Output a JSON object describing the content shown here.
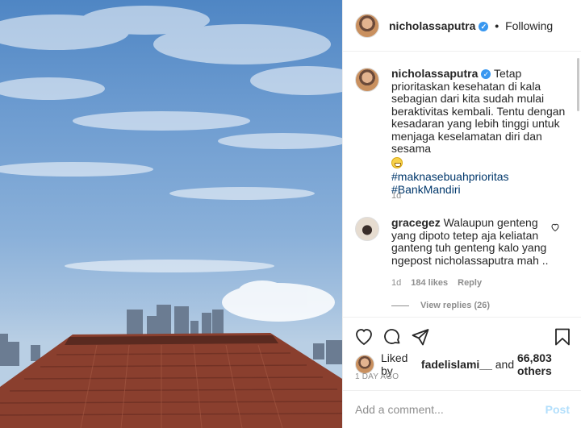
{
  "header": {
    "username": "nicholassaputra",
    "separator": "•",
    "follow_status": "Following"
  },
  "caption": {
    "username": "nicholassaputra",
    "text": "Tetap prioritaskan kesehatan di kala sebagian dari kita sudah mulai beraktivitas kembali. Tentu dengan kesadaran yang lebih tinggi untuk menjaga keselamatan diri dan sesama",
    "hashtags": [
      "#maknasebuahprioritas",
      "#BankMandiri"
    ],
    "time": "1d"
  },
  "comment": {
    "username": "gracegez",
    "text": "Walaupun genteng yang dipoto tetep aja keliatan ganteng tuh genteng kalo yang ngepost nicholassaputra mah ..",
    "time": "1d",
    "likes": "184 likes",
    "reply_label": "Reply",
    "view_replies": "View replies (26)"
  },
  "likes": {
    "prefix": "Liked by",
    "user": "fadelislami__",
    "conj": "and",
    "count": "66,803 others"
  },
  "post_age": "1 DAY AGO",
  "add_comment": {
    "placeholder": "Add a comment...",
    "post_label": "Post"
  },
  "colors": {
    "verified": "#3897f0",
    "hashtag": "#00376b",
    "post_disabled": "#b2dffc",
    "muted": "#8e8e8e"
  }
}
